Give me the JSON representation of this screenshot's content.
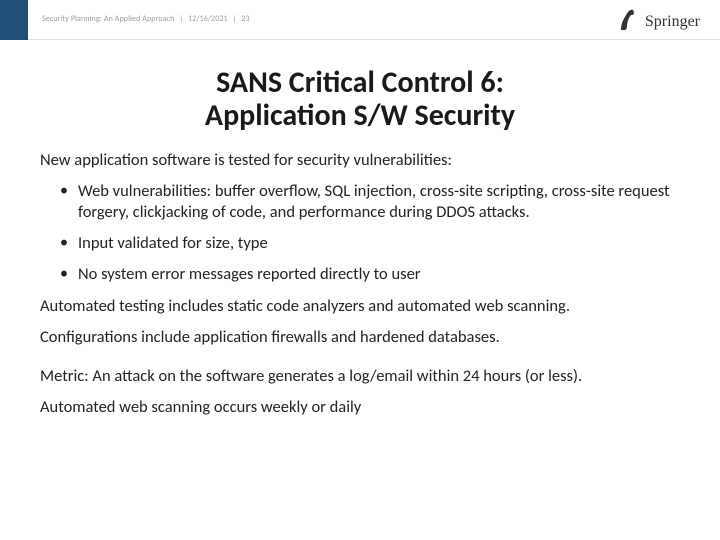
{
  "header": {
    "meta_title": "Security Planning: An Applied Approach",
    "meta_date": "12/16/2021",
    "meta_page": "23",
    "publisher": "Springer"
  },
  "title_line1": "SANS Critical Control 6:",
  "title_line2": "Application S/W Security",
  "body": {
    "intro": "New application software is tested for security vulnerabilities:",
    "bullets": [
      "Web vulnerabilities: buffer overflow, SQL injection, cross-site scripting, cross-site request forgery, clickjacking of code, and performance during DDOS attacks.",
      "Input validated for size, type",
      "No system error messages reported directly to user"
    ],
    "para2": "Automated testing includes static code analyzers and automated web scanning.",
    "para3": "Configurations include application firewalls and hardened databases.",
    "para4": "Metric:  An attack on the software generates a log/email within 24 hours (or less).",
    "para5": "Automated web scanning occurs weekly or daily"
  }
}
